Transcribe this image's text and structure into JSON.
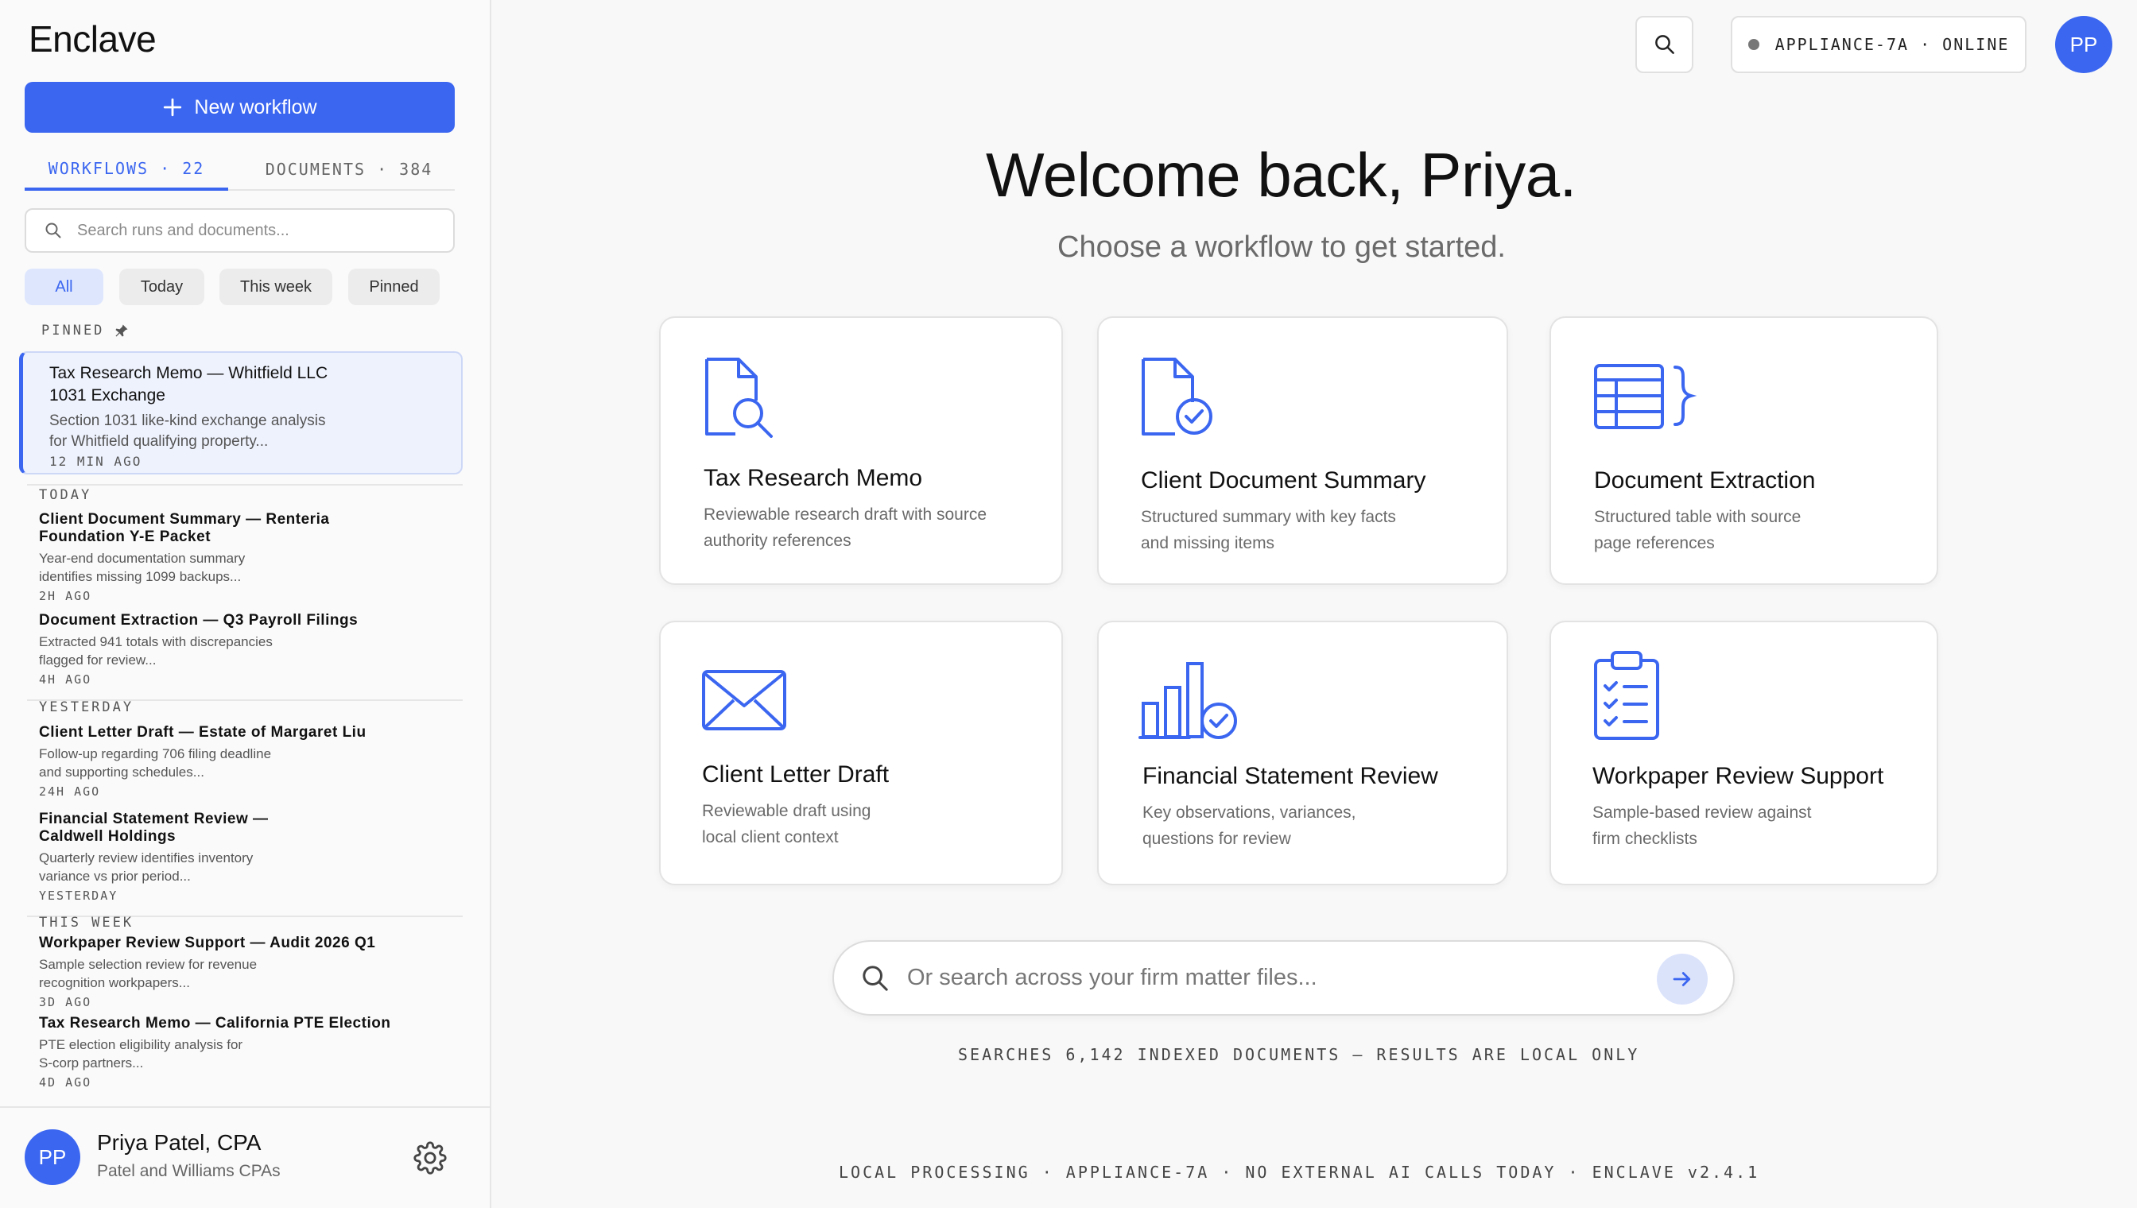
{
  "app": {
    "name": "Enclave"
  },
  "sidebar": {
    "new_workflow_label": "New workflow",
    "tabs": [
      {
        "label": "WORKFLOWS · 22",
        "active": true
      },
      {
        "label": "DOCUMENTS · 384",
        "active": false
      }
    ],
    "search_placeholder": "Search runs and documents...",
    "filters": [
      {
        "label": "All",
        "active": true
      },
      {
        "label": "Today",
        "active": false
      },
      {
        "label": "This week",
        "active": false
      },
      {
        "label": "Pinned",
        "active": false
      }
    ],
    "sections": {
      "pinned": "PINNED",
      "today": "TODAY",
      "yesterday": "YESTERDAY",
      "this_week": "THIS WEEK"
    },
    "pinned_run": {
      "title_line1": "Tax Research Memo — Whitfield LLC",
      "title_line2": "1031 Exchange",
      "desc_line1": "Section 1031 like-kind exchange analysis",
      "desc_line2": "for Whitfield qualifying property...",
      "time": "12 MIN AGO"
    },
    "runs": [
      {
        "title_line1": "Client Document Summary — Renteria",
        "title_line2": "Foundation Y-E Packet",
        "desc_line1": "Year-end documentation summary",
        "desc_line2": "identifies missing 1099 backups...",
        "time": "2H AGO"
      },
      {
        "title_line1": "Document Extraction — Q3 Payroll Filings",
        "title_line2": "",
        "desc_line1": "Extracted 941 totals with discrepancies",
        "desc_line2": "flagged for review...",
        "time": "4H AGO"
      },
      {
        "title_line1": "Client Letter Draft — Estate of Margaret Liu",
        "title_line2": "",
        "desc_line1": "Follow-up regarding 706 filing deadline",
        "desc_line2": "and supporting schedules...",
        "time": "24H AGO"
      },
      {
        "title_line1": "Financial Statement Review —",
        "title_line2": "Caldwell Holdings",
        "desc_line1": "Quarterly review identifies inventory",
        "desc_line2": "variance vs prior period...",
        "time": "YESTERDAY"
      },
      {
        "title_line1": "Workpaper Review Support — Audit 2026 Q1",
        "title_line2": "",
        "desc_line1": "Sample selection review for revenue",
        "desc_line2": "recognition workpapers...",
        "time": "3D AGO"
      },
      {
        "title_line1": "Tax Research Memo — California PTE Election",
        "title_line2": "",
        "desc_line1": "PTE election eligibility analysis for",
        "desc_line2": "S-corp partners...",
        "time": "4D AGO"
      }
    ],
    "profile": {
      "initials": "PP",
      "name": "Priya Patel, CPA",
      "org": "Patel and Williams CPAs"
    }
  },
  "topbar": {
    "status": "APPLIANCE-7A · ONLINE",
    "avatar_initials": "PP"
  },
  "main": {
    "welcome": "Welcome back, Priya.",
    "subtitle": "Choose a workflow to get started.",
    "cards": [
      {
        "icon": "document-search-icon",
        "title": "Tax Research Memo",
        "desc_line1": "Reviewable research draft with source",
        "desc_line2": "authority references"
      },
      {
        "icon": "document-check-icon",
        "title": "Client Document Summary",
        "desc_line1": "Structured summary with key facts",
        "desc_line2": "and missing items"
      },
      {
        "icon": "table-extract-icon",
        "title": "Document Extraction",
        "desc_line1": "Structured table with source",
        "desc_line2": "page references"
      },
      {
        "icon": "envelope-icon",
        "title": "Client Letter Draft",
        "desc_line1": "Reviewable draft using",
        "desc_line2": "local client context"
      },
      {
        "icon": "bar-chart-check-icon",
        "title": "Financial Statement Review",
        "desc_line1": "Key observations, variances,",
        "desc_line2": "questions for review"
      },
      {
        "icon": "clipboard-checklist-icon",
        "title": "Workpaper Review Support",
        "desc_line1": "Sample-based review against",
        "desc_line2": "firm checklists"
      }
    ],
    "search_placeholder": "Or search across your firm matter files...",
    "search_note": "SEARCHES 6,142 INDEXED DOCUMENTS — RESULTS ARE LOCAL ONLY",
    "footer": "LOCAL PROCESSING · APPLIANCE-7A · NO EXTERNAL AI CALLS TODAY · ENCLAVE v2.4.1"
  },
  "colors": {
    "accent": "#3b66f0",
    "accent_soft": "#dde6fd",
    "status_dot": "#777777"
  }
}
